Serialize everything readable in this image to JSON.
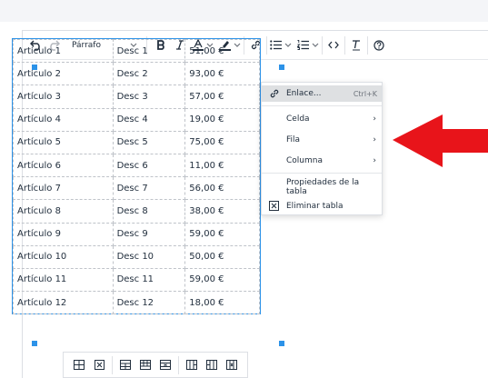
{
  "toolbar": {
    "block_format": "Párrafo"
  },
  "table": {
    "rows": [
      [
        "Artículo 1",
        "Desc 1",
        "51,00 €"
      ],
      [
        "Artículo 2",
        "Desc 2",
        "93,00 €"
      ],
      [
        "Artículo 3",
        "Desc 3",
        "57,00 €"
      ],
      [
        "Artículo 4",
        "Desc 4",
        "19,00 €"
      ],
      [
        "Artículo 5",
        "Desc 5",
        "75,00 €"
      ],
      [
        "Artículo 6",
        "Desc 6",
        "11,00 €"
      ],
      [
        "Artículo 7",
        "Desc 7",
        "56,00 €"
      ],
      [
        "Artículo 8",
        "Desc 8",
        "38,00 €"
      ],
      [
        "Artículo 9",
        "Desc 9",
        "59,00 €"
      ],
      [
        "Artículo 10",
        "Desc 10",
        "50,00 €"
      ],
      [
        "Artículo 11",
        "Desc 11",
        "59,00 €"
      ],
      [
        "Artículo 12",
        "Desc 12",
        "18,00 €"
      ]
    ]
  },
  "context_menu": {
    "link_label": "Enlace...",
    "link_shortcut": "Ctrl+K",
    "cell_label": "Celda",
    "row_label": "Fila",
    "column_label": "Columna",
    "table_props_label": "Propiedades de la tabla",
    "delete_table_label": "Eliminar tabla",
    "submenu_glyph": "›"
  },
  "colors": {
    "accent": "#2c92e8",
    "arrow": "#e8141a",
    "highlight": "#dee0e2"
  }
}
